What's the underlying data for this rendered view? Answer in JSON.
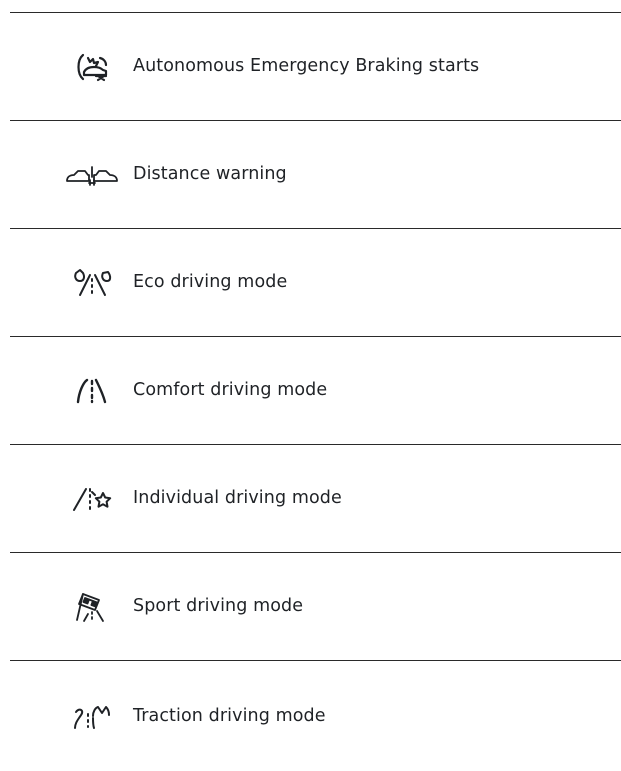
{
  "items": [
    {
      "icon": "autonomous-emergency-braking-icon",
      "label": "Autonomous Emergency Braking starts"
    },
    {
      "icon": "distance-warning-icon",
      "label": "Distance warning"
    },
    {
      "icon": "eco-driving-mode-icon",
      "label": "Eco driving mode"
    },
    {
      "icon": "comfort-driving-mode-icon",
      "label": "Comfort driving mode"
    },
    {
      "icon": "individual-driving-mode-icon",
      "label": "Individual driving mode"
    },
    {
      "icon": "sport-driving-mode-icon",
      "label": "Sport driving mode"
    },
    {
      "icon": "traction-driving-mode-icon",
      "label": "Traction driving mode"
    }
  ],
  "colors": {
    "text": "#1f2226",
    "divider": "#2a2a2a"
  }
}
